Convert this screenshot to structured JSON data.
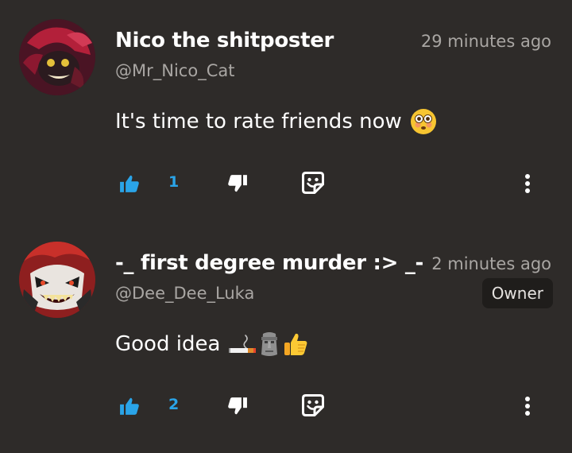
{
  "comments": [
    {
      "author": "Nico the shitposter",
      "handle": "@Mr_Nico_Cat",
      "time": "29 minutes ago",
      "badge": "",
      "text": "It's time to rate friends now",
      "emojis": [
        "flushed-face-emoji"
      ],
      "likes": "1"
    },
    {
      "author": "-_ first degree murder :> _-",
      "handle": "@Dee_Dee_Luka",
      "time": "2 minutes ago",
      "badge": "Owner",
      "text": "Good idea",
      "emojis": [
        "cigarette-emoji",
        "moai-emoji",
        "thumbs-up-emoji"
      ],
      "likes": "2"
    }
  ],
  "colors": {
    "background": "#2e2b29",
    "accent": "#2aa4e8",
    "muted_text": "#a9a6a3",
    "badge_bg": "#1f1d1b"
  },
  "icons": {
    "like": "thumbs-up-icon",
    "dislike": "thumbs-down-icon",
    "reply": "reply-sticker-icon",
    "more": "kebab-menu-icon"
  }
}
